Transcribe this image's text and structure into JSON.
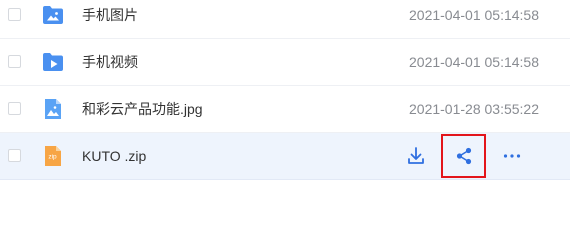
{
  "files": [
    {
      "name": "手机图片",
      "date": "2021-04-01 05:14:58",
      "icon": "folder-image-icon"
    },
    {
      "name": "手机视频",
      "date": "2021-04-01 05:14:58",
      "icon": "folder-video-icon"
    },
    {
      "name": "和彩云产品功能.jpg",
      "date": "2021-01-28 03:55:22",
      "icon": "image-file-icon"
    },
    {
      "name": "KUTO .zip",
      "icon": "zip-file-icon",
      "zip_badge": "zip"
    }
  ],
  "actions": {
    "download_icon": "download-icon",
    "share_icon": "share-icon",
    "more_icon": "more-icon"
  },
  "colors": {
    "folder_blue": "#4a90f0",
    "zip_orange": "#f7a545",
    "action_blue": "#2f6fe0",
    "highlight_red": "#e3151b",
    "selected_row_bg": "#eef4fd"
  }
}
